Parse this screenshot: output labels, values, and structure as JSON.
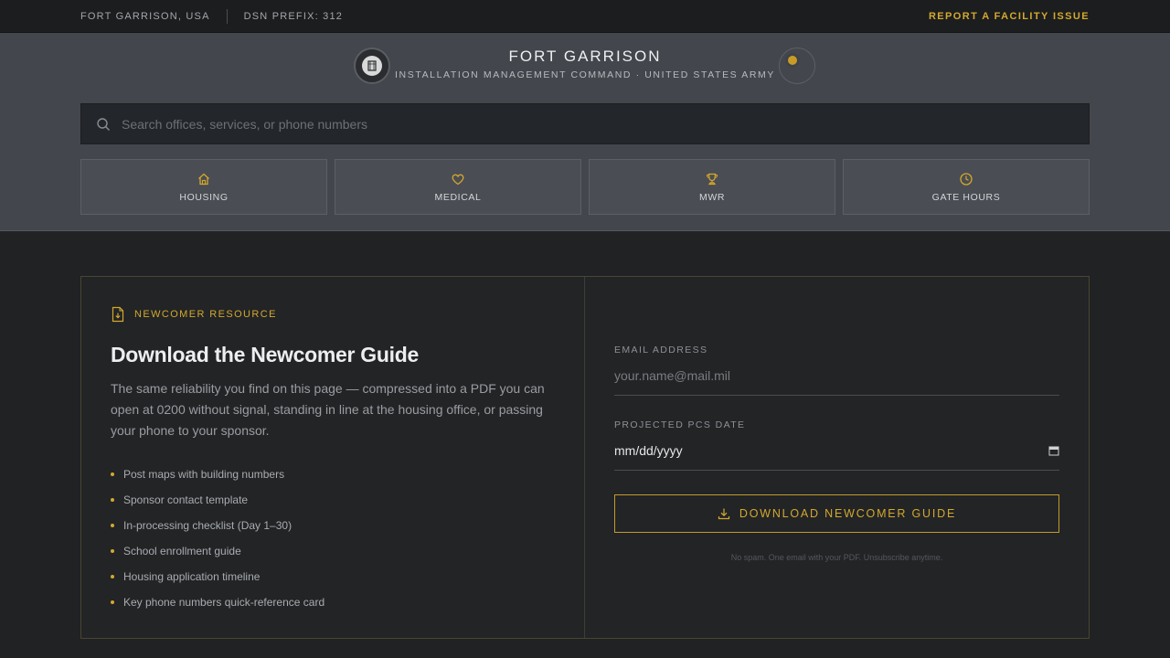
{
  "topbar": {
    "location": "FORT GARRISON, USA",
    "dsn": "DSN PREFIX: 312",
    "report_link": "REPORT A FACILITY ISSUE"
  },
  "brand": {
    "title": "FORT GARRISON",
    "subtitle": "INSTALLATION MANAGEMENT COMMAND · UNITED STATES ARMY"
  },
  "search": {
    "placeholder": "Search offices, services, or phone numbers"
  },
  "quicklinks": [
    {
      "label": "HOUSING",
      "icon": "home-icon"
    },
    {
      "label": "MEDICAL",
      "icon": "heart-icon"
    },
    {
      "label": "MWR",
      "icon": "trophy-icon"
    },
    {
      "label": "GATE HOURS",
      "icon": "clock-icon"
    }
  ],
  "newcomer": {
    "eyebrow": "NEWCOMER RESOURCE",
    "title": "Download the Newcomer Guide",
    "description": "The same reliability you find on this page — compressed into a PDF you can open at 0200 without signal, standing in line at the housing office, or passing your phone to your sponsor.",
    "bullets": [
      "Post maps with building numbers",
      "Sponsor contact template",
      "In-processing checklist (Day 1–30)",
      "School enrollment guide",
      "Housing application timeline",
      "Key phone numbers quick-reference card"
    ]
  },
  "form": {
    "email_label": "EMAIL ADDRESS",
    "email_placeholder": "your.name@mail.mil",
    "date_label": "PROJECTED PCS DATE",
    "date_value": "mm/dd/yyyy",
    "button_label": "DOWNLOAD NEWCOMER GUIDE",
    "fine_print": "No spam. One email with your PDF. Unsubscribe anytime."
  },
  "colors": {
    "accent": "#d4a82e",
    "header_bg": "#43464c",
    "page_bg": "#202224"
  }
}
